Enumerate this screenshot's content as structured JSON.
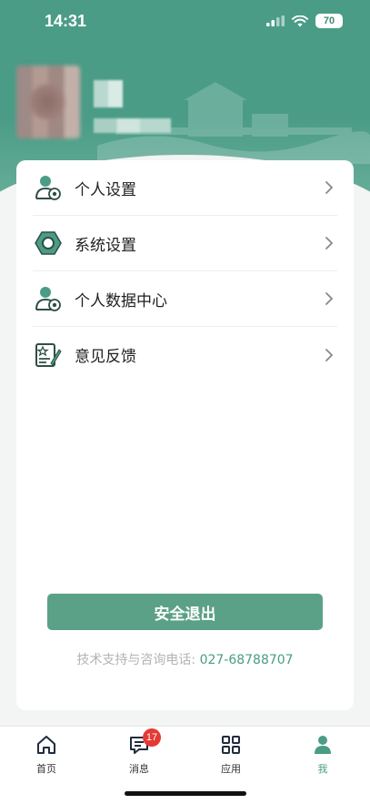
{
  "status_bar": {
    "time": "14:31",
    "battery": "70"
  },
  "menu": [
    {
      "label": "个人设置",
      "icon": "user-settings-icon"
    },
    {
      "label": "系统设置",
      "icon": "hex-nut-icon"
    },
    {
      "label": "个人数据中心",
      "icon": "user-data-icon"
    },
    {
      "label": "意见反馈",
      "icon": "feedback-icon"
    }
  ],
  "logout_label": "安全退出",
  "support": {
    "text": "技术支持与咨询电话:",
    "phone": "027-68788707"
  },
  "tabs": [
    {
      "label": "首页",
      "icon": "home-icon"
    },
    {
      "label": "消息",
      "icon": "message-icon",
      "badge": "17"
    },
    {
      "label": "应用",
      "icon": "apps-grid-icon"
    },
    {
      "label": "我",
      "icon": "profile-icon",
      "active": true
    }
  ],
  "colors": {
    "primary": "#4a9c86",
    "button": "#5ba187",
    "badge": "#e53935"
  }
}
